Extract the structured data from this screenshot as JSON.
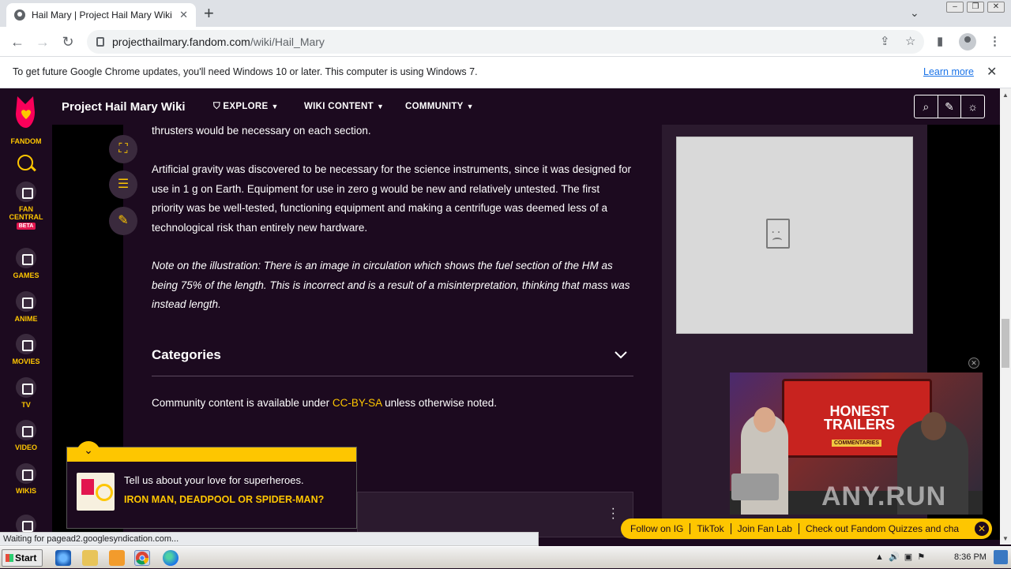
{
  "browser": {
    "tab_title": "Hail Mary | Project Hail Mary Wiki | F",
    "tab_close": "✕",
    "new_tab": "+",
    "url_host": "projecthailmary.fandom.com",
    "url_path": "/wiki/Hail_Mary",
    "infobar_message": "To get future Google Chrome updates, you'll need Windows 10 or later. This computer is using Windows 7.",
    "infobar_link": "Learn more"
  },
  "rail": {
    "logo_label": "FANDOM",
    "fan_central_line1": "FAN",
    "fan_central_line2": "CENTRAL",
    "beta_badge": "BETA",
    "items": [
      {
        "label": "GAMES"
      },
      {
        "label": "ANIME"
      },
      {
        "label": "MOVIES"
      },
      {
        "label": "TV"
      },
      {
        "label": "VIDEO"
      },
      {
        "label": "WIKIS"
      }
    ]
  },
  "topnav": {
    "wiki_title": "Project Hail Mary Wiki",
    "explore": "EXPLORE",
    "wiki_content": "WIKI CONTENT",
    "community": "COMMUNITY"
  },
  "article": {
    "para_top": "thrusters would be necessary on each section.",
    "para_gravity": "Artificial gravity was discovered to be necessary for the science instruments, since it was designed for use in 1 g on Earth. Equipment for use in zero g would be new and relatively untested. The first priority was be well-tested, functioning equipment and making a centrifuge was deemed less of a technological risk than entirely new hardware.",
    "para_note": "Note on the illustration: There is an image in circulation which shows the fuel section of the HM as being 75% of the length. This is incorrect and is a result of a misinterpretation, thinking that mass was instead length.",
    "categories_title": "Categories",
    "license_prefix": "Community content is available under ",
    "license_link": "CC-BY-SA",
    "license_suffix": " unless otherwise noted."
  },
  "video": {
    "sign_line1": "HONEST",
    "sign_line2": "TRAILERS",
    "sign_sub": "COMMENTARIES",
    "watermark": "ANY.RUN"
  },
  "banner": {
    "items": [
      "Follow on IG",
      "TikTok",
      "Join Fan Lab",
      "Check out Fandom Quizzes and cha"
    ]
  },
  "quiz": {
    "question": "Tell us about your love for superheroes.",
    "answer": "IRON MAN, DEADPOOL OR SPIDER-MAN?"
  },
  "status_text": "Waiting for pagead2.googlesyndication.com...",
  "taskbar": {
    "start": "Start",
    "time": "8:36 PM"
  },
  "colors": {
    "fandom_yellow": "#fec600",
    "fandom_bg": "#1c0a1f",
    "chrome_link": "#1a73e8"
  }
}
